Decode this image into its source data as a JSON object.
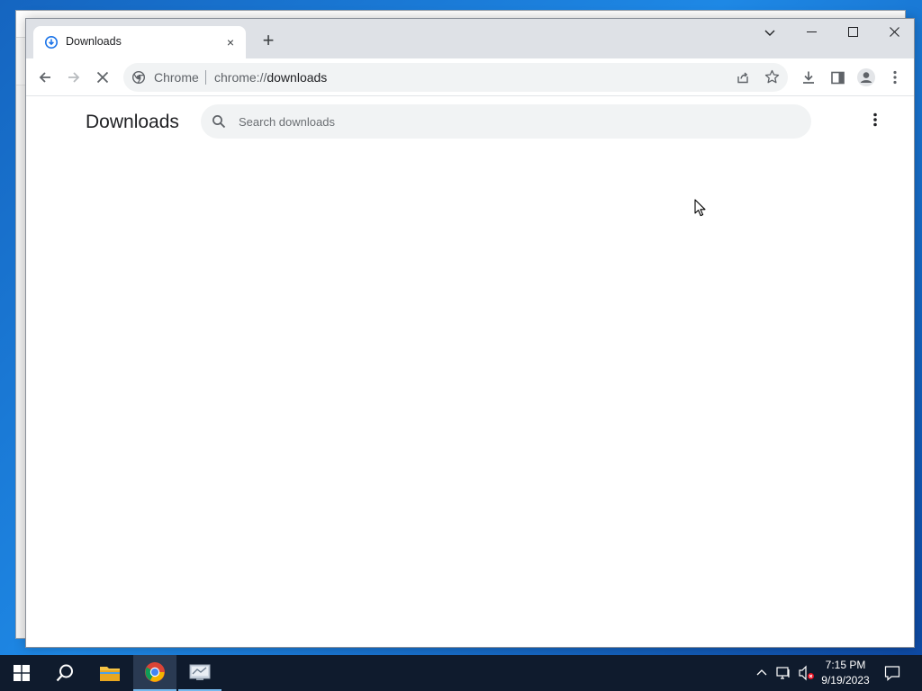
{
  "browser": {
    "tab": {
      "title": "Downloads",
      "close_label": "×"
    },
    "new_tab_label": "+",
    "omnibox": {
      "chip_label": "Chrome",
      "url_scheme": "chrome://",
      "url_path": "downloads"
    }
  },
  "page": {
    "title": "Downloads",
    "search": {
      "placeholder": "Search downloads",
      "value": ""
    }
  },
  "taskbar": {
    "time": "7:15 PM",
    "date": "9/19/2023",
    "items": [
      "start",
      "search",
      "file-explorer",
      "chrome",
      "network-app"
    ]
  },
  "colors": {
    "accent_blue": "#1a73e8",
    "taskbar_bg": "#0f1b2d",
    "tab_strip_bg": "#dee1e6"
  }
}
